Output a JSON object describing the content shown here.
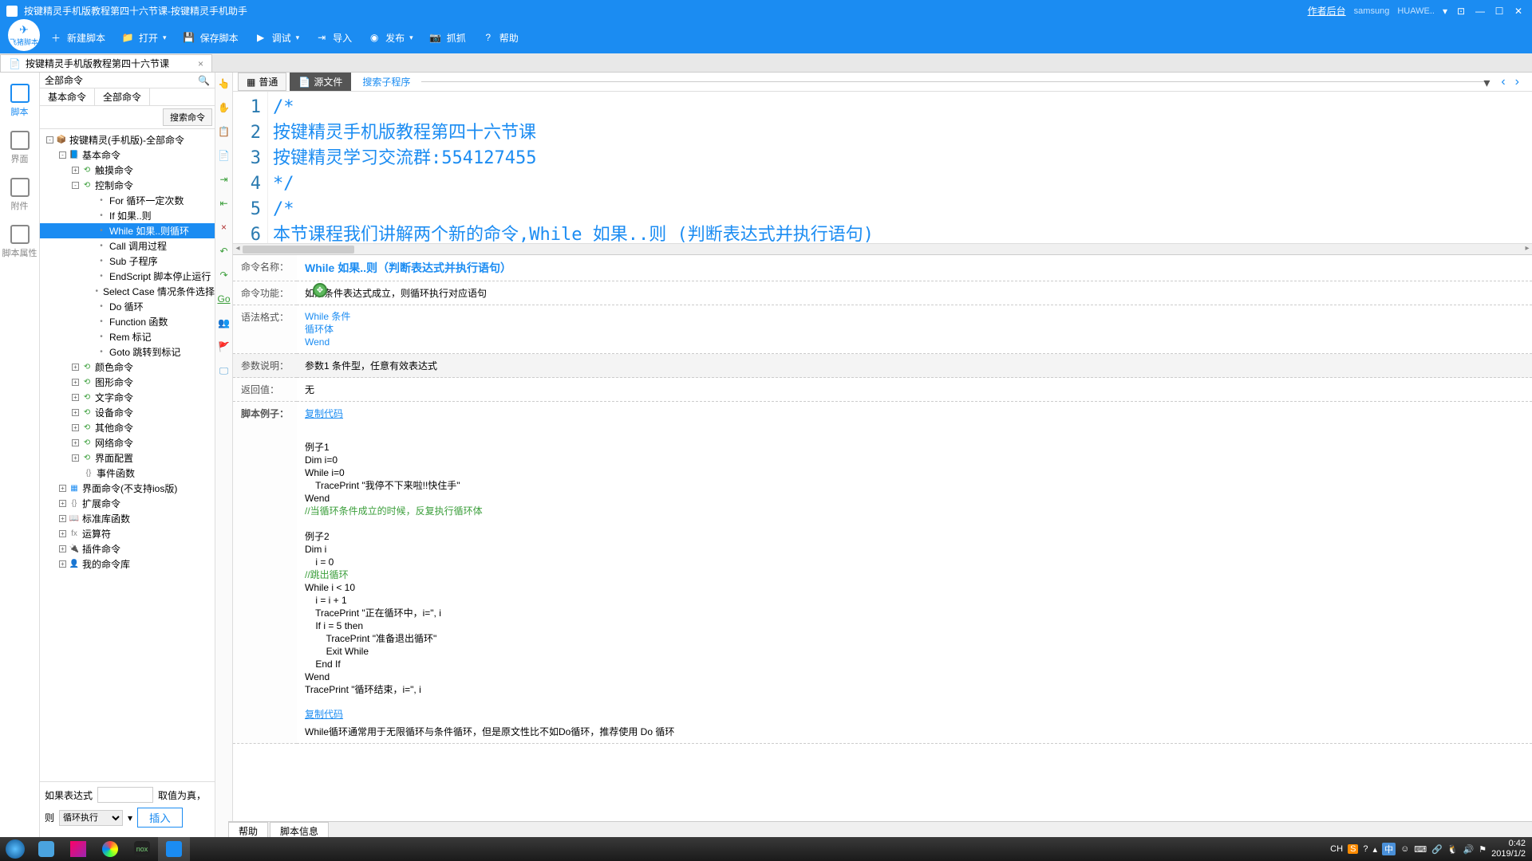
{
  "title": "按键精灵手机版教程第四十六节课-按键精灵手机助手",
  "titlebar_right": {
    "author": "作者后台",
    "device_brand": "samsung",
    "device_model": "HUAWE.."
  },
  "logo_text": "飞猪脚本",
  "toolbar": [
    {
      "icon": "＋",
      "label": "新建脚本"
    },
    {
      "icon": "📁",
      "label": "打开",
      "arrow": true
    },
    {
      "icon": "💾",
      "label": "保存脚本"
    },
    {
      "icon": "▶",
      "label": "调试",
      "arrow": true
    },
    {
      "icon": "⇥",
      "label": "导入"
    },
    {
      "icon": "◉",
      "label": "发布",
      "arrow": true
    },
    {
      "icon": "📷",
      "label": "抓抓"
    },
    {
      "icon": "?",
      "label": "帮助"
    }
  ],
  "tab": "按键精灵手机版教程第四十六节课",
  "nav": [
    {
      "label": "脚本",
      "active": true
    },
    {
      "label": "界面"
    },
    {
      "label": "附件"
    },
    {
      "label": "脚本属性"
    }
  ],
  "cmd_header": "全部命令",
  "cmd_tabs": [
    "基本命令",
    "全部命令"
  ],
  "search_btn": "搜索命令",
  "tree": [
    {
      "indent": 0,
      "exp": "-",
      "icon": "📦",
      "iconcls": "purple-icon",
      "label": "按键精灵(手机版)-全部命令"
    },
    {
      "indent": 1,
      "exp": "-",
      "icon": "📘",
      "iconcls": "blue-icon",
      "label": "基本命令"
    },
    {
      "indent": 2,
      "exp": "+",
      "icon": "⟲",
      "iconcls": "green-icon",
      "label": "触摸命令"
    },
    {
      "indent": 2,
      "exp": "-",
      "icon": "⟲",
      "iconcls": "green-icon",
      "label": "控制命令"
    },
    {
      "indent": 3,
      "noexp": true,
      "icon": "•",
      "iconcls": "cmd-icon",
      "label": "For 循环一定次数"
    },
    {
      "indent": 3,
      "noexp": true,
      "icon": "•",
      "iconcls": "cmd-icon",
      "label": "If 如果..则"
    },
    {
      "indent": 3,
      "noexp": true,
      "icon": "•",
      "iconcls": "cmd-icon",
      "label": "While 如果..则循环",
      "selected": true
    },
    {
      "indent": 3,
      "noexp": true,
      "icon": "•",
      "iconcls": "cmd-icon",
      "label": "Call 调用过程"
    },
    {
      "indent": 3,
      "noexp": true,
      "icon": "•",
      "iconcls": "cmd-icon",
      "label": "Sub 子程序"
    },
    {
      "indent": 3,
      "noexp": true,
      "icon": "•",
      "iconcls": "cmd-icon",
      "label": "EndScript 脚本停止运行"
    },
    {
      "indent": 3,
      "noexp": true,
      "icon": "•",
      "iconcls": "cmd-icon",
      "label": "Select Case 情况条件选择"
    },
    {
      "indent": 3,
      "noexp": true,
      "icon": "•",
      "iconcls": "cmd-icon",
      "label": "Do 循环"
    },
    {
      "indent": 3,
      "noexp": true,
      "icon": "•",
      "iconcls": "cmd-icon",
      "label": "Function 函数"
    },
    {
      "indent": 3,
      "noexp": true,
      "icon": "•",
      "iconcls": "cmd-icon",
      "label": "Rem 标记"
    },
    {
      "indent": 3,
      "noexp": true,
      "icon": "•",
      "iconcls": "cmd-icon",
      "label": "Goto 跳转到标记"
    },
    {
      "indent": 2,
      "exp": "+",
      "icon": "⟲",
      "iconcls": "green-icon",
      "label": "颜色命令"
    },
    {
      "indent": 2,
      "exp": "+",
      "icon": "⟲",
      "iconcls": "green-icon",
      "label": "图形命令"
    },
    {
      "indent": 2,
      "exp": "+",
      "icon": "⟲",
      "iconcls": "green-icon",
      "label": "文字命令"
    },
    {
      "indent": 2,
      "exp": "+",
      "icon": "⟲",
      "iconcls": "green-icon",
      "label": "设备命令"
    },
    {
      "indent": 2,
      "exp": "+",
      "icon": "⟲",
      "iconcls": "green-icon",
      "label": "其他命令"
    },
    {
      "indent": 2,
      "exp": "+",
      "icon": "⟲",
      "iconcls": "green-icon",
      "label": "网络命令"
    },
    {
      "indent": 2,
      "exp": "+",
      "icon": "⟲",
      "iconcls": "green-icon",
      "label": "界面配置"
    },
    {
      "indent": 2,
      "noexp": true,
      "icon": "{}",
      "iconcls": "cmd-icon",
      "label": "事件函数"
    },
    {
      "indent": 1,
      "exp": "+",
      "icon": "▦",
      "iconcls": "blue-icon",
      "label": "界面命令(不支持ios版)"
    },
    {
      "indent": 1,
      "exp": "+",
      "icon": "{}",
      "iconcls": "cmd-icon",
      "label": "扩展命令"
    },
    {
      "indent": 1,
      "exp": "+",
      "icon": "📖",
      "iconcls": "orange-icon",
      "label": "标准库函数"
    },
    {
      "indent": 1,
      "exp": "+",
      "icon": "fx",
      "iconcls": "cmd-icon",
      "label": "运算符"
    },
    {
      "indent": 1,
      "exp": "+",
      "icon": "🔌",
      "iconcls": "green-icon",
      "label": "插件命令"
    },
    {
      "indent": 1,
      "exp": "+",
      "icon": "👤",
      "iconcls": "orange-icon",
      "label": "我的命令库"
    }
  ],
  "cmd_bottom": {
    "expr_label": "如果表达式",
    "result_label": "取值为真，",
    "then_label": "则",
    "loop_exec": "循环执行",
    "insert": "插入"
  },
  "editor_tabs": {
    "normal": "普通",
    "source": "源文件",
    "search_sub": "搜索子程序"
  },
  "code_lines": [
    "/*",
    "按键精灵手机版教程第四十六节课",
    "按键精灵学习交流群:554127455",
    "*/",
    "/*",
    "本节课程我们讲解两个新的命令,While 如果..则 (判断表达式并执行语句)"
  ],
  "help": {
    "name_label": "命令名称：",
    "name_value": "While 如果..则（判断表达式并执行语句）",
    "func_label": "命令功能：",
    "func_value": "如果条件表达式成立，则循环执行对应语句",
    "syntax_label": "语法格式：",
    "syntax_l1": "While 条件",
    "syntax_l2": "循环体",
    "syntax_l3": "Wend",
    "param_label": "参数说明：",
    "param_value": "参数1 条件型，任意有效表达式",
    "return_label": "返回值：",
    "return_value": "无",
    "copy": "复制代码",
    "example_label": "脚本例子：",
    "ex1_title": "例子1",
    "ex1_l1": "Dim i=0",
    "ex1_l2": "While i=0",
    "ex1_l3": "    TracePrint \"我停不下来啦!!快住手\"",
    "ex1_l4": "Wend",
    "ex1_comment": "//当循环条件成立的时候，反复执行循环体",
    "ex2_title": "例子2",
    "ex2_l1": "Dim i",
    "ex2_l2": "    i = 0",
    "ex2_comment": "//跳出循环",
    "ex2_l3": "While i < 10",
    "ex2_l4": "    i = i + 1",
    "ex2_l5": "    TracePrint \"正在循环中，i=\", i",
    "ex2_l6": "    If i = 5 then",
    "ex2_l7": "        TracePrint \"准备退出循环\"",
    "ex2_l8": "        Exit While",
    "ex2_l9": "    End If",
    "ex2_l10": "Wend",
    "ex2_l11": "TracePrint \"循环结束，i=\", i",
    "note": "While循环通常用于无限循环与条件循环，但是原文性比不如Do循环，推荐使用 Do 循环"
  },
  "help_tabs": [
    "帮助",
    "脚本信息"
  ],
  "taskbar": {
    "time": "0:42",
    "date": "2019/1/2",
    "ime": "CH",
    "lang_icon": "中"
  }
}
